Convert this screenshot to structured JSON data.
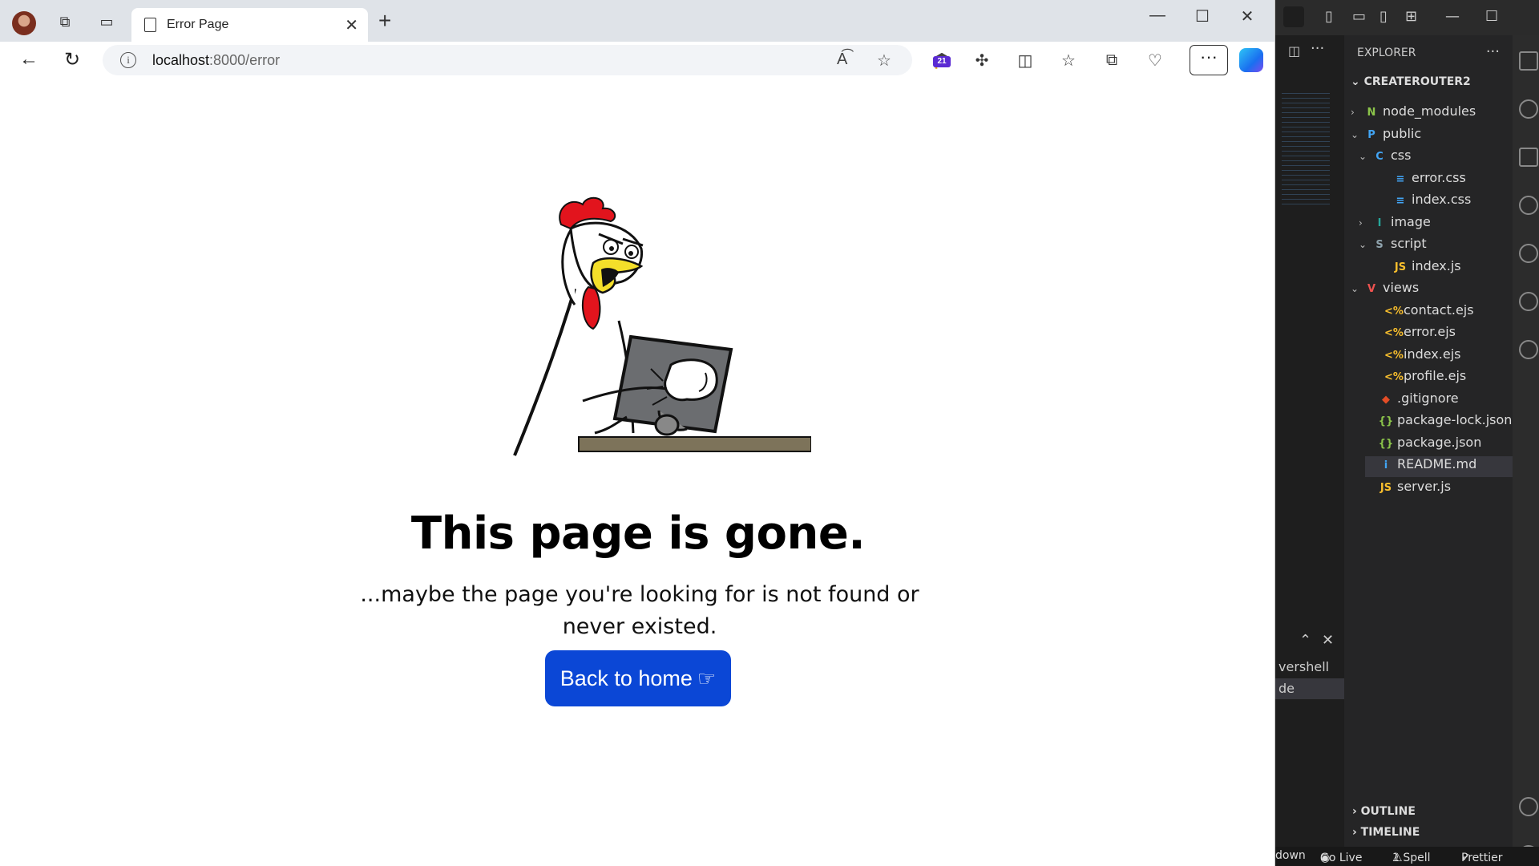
{
  "browser": {
    "tab_title": "Error Page",
    "url_host": "localhost",
    "url_path": ":8000/error",
    "extension_badge": "21",
    "more_label": "···"
  },
  "page": {
    "heading": "This page is gone.",
    "message": "...maybe the page you're looking for is not found or never existed.",
    "button_label": "Back to home",
    "button_color": "#0b47d6"
  },
  "vscode": {
    "explorer_title": "EXPLORER",
    "project": "CREATEROUTER2",
    "tree": [
      {
        "label": "node_modules",
        "type": "folder",
        "icon": "N",
        "color": "#8bc34a"
      },
      {
        "label": "public",
        "type": "folder-open",
        "icon": "P",
        "color": "#42a5f5"
      },
      {
        "label": "css",
        "type": "folder-open",
        "icon": "C",
        "color": "#42a5f5"
      },
      {
        "label": "error.css",
        "type": "file",
        "icon": "≡",
        "color": "#42a5f5"
      },
      {
        "label": "index.css",
        "type": "file",
        "icon": "≡",
        "color": "#42a5f5"
      },
      {
        "label": "image",
        "type": "folder",
        "icon": "I",
        "color": "#26a69a"
      },
      {
        "label": "script",
        "type": "folder-open",
        "icon": "S",
        "color": "#90a4ae"
      },
      {
        "label": "index.js",
        "type": "file",
        "icon": "JS",
        "color": "#fbc02d"
      },
      {
        "label": "views",
        "type": "folder-open",
        "icon": "V",
        "color": "#ef5350"
      },
      {
        "label": "contact.ejs",
        "type": "file",
        "icon": "<%",
        "color": "#fbc02d"
      },
      {
        "label": "error.ejs",
        "type": "file",
        "icon": "<%",
        "color": "#fbc02d"
      },
      {
        "label": "index.ejs",
        "type": "file",
        "icon": "<%",
        "color": "#fbc02d"
      },
      {
        "label": "profile.ejs",
        "type": "file",
        "icon": "<%",
        "color": "#fbc02d"
      },
      {
        "label": ".gitignore",
        "type": "file",
        "icon": "◆",
        "color": "#e44d26"
      },
      {
        "label": "package-lock.json",
        "type": "file",
        "icon": "{}",
        "color": "#8bc34a"
      },
      {
        "label": "package.json",
        "type": "file",
        "icon": "{}",
        "color": "#8bc34a"
      },
      {
        "label": "README.md",
        "type": "file",
        "icon": "i",
        "color": "#42a5f5"
      },
      {
        "label": "server.js",
        "type": "file",
        "icon": "JS",
        "color": "#fbc02d"
      }
    ],
    "terminal_name": "vershell",
    "terminal_selected": "de",
    "outline": "OUTLINE",
    "timeline": "TIMELINE",
    "status": {
      "item1": "down",
      "go_live": "Go Live",
      "spell": "1 Spell",
      "prettier": "Prettier"
    }
  }
}
